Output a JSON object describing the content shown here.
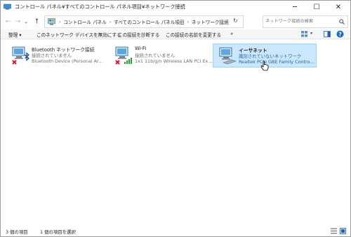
{
  "window": {
    "title": "コントロール パネル¥すべてのコントロール パネル項目¥ネットワーク接続",
    "controls": {
      "minimize": "─",
      "maximize": "☐",
      "close": "✕"
    }
  },
  "nav": {
    "back": "←",
    "forward": "→",
    "recent": "⌄",
    "up": "↑",
    "refresh": "↻"
  },
  "address": {
    "crumbs": [
      "コントロール パネル",
      "すべてのコントロール パネル項目",
      "ネットワーク接続"
    ],
    "separator": "›",
    "dropdown": "⌄"
  },
  "search": {
    "placeholder": "ネットワーク接続の検索",
    "icon": "search-icon"
  },
  "toolbar": {
    "organize": "整理 ▾",
    "disable": "このネットワーク デバイスを無効にする",
    "diagnose": "この接続を診断する",
    "rename": "この接続の名前を変更する",
    "more": "»"
  },
  "connections": [
    {
      "name": "Bluetooth ネットワーク接続",
      "status": "接続されていません",
      "device": "Bluetooth Device (Personal Area ...",
      "icon": "bluetooth-adapter-icon"
    },
    {
      "name": "Wi-Fi",
      "status": "接続されていません",
      "device": "1x1 11b/g/n Wireless LAN PCI Exp...",
      "icon": "wifi-adapter-icon"
    },
    {
      "name": "イーサネット",
      "status": "識別されていないネットワーク",
      "device": "Realtek PCIe GBE Family Controller",
      "icon": "ethernet-adapter-icon"
    }
  ],
  "statusbar": {
    "count": "3 個の項目",
    "selected": "1 個の項目を選択"
  },
  "colors": {
    "selection": "#cce8ff",
    "selection_border": "#99d1ff",
    "link": "#1a5fb4",
    "error": "#e81123"
  }
}
